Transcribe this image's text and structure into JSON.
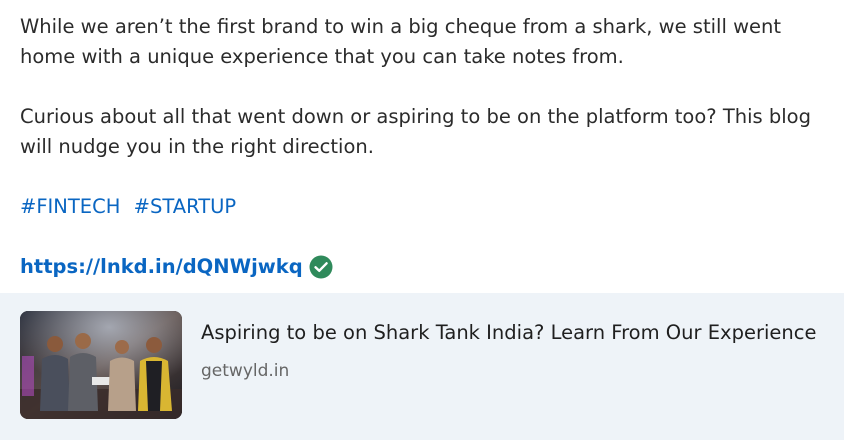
{
  "post": {
    "paragraph1": "While we aren’t the first brand to win a big cheque from a shark, we still went home with a unique experience that you can take notes from.",
    "paragraph2": "Curious about all that went down or aspiring to be on the platform too? This blog will nudge you in the right direction.",
    "hashtags": [
      "#FINTECH",
      "#STARTUP"
    ],
    "link": {
      "text": "https://lnkd.in/dQNWjwkq",
      "verified_icon": "check-circle-icon"
    }
  },
  "link_preview": {
    "title": "Aspiring to be on Shark Tank India? Learn From Our Experience",
    "domain": "getwyld.in",
    "thumbnail_icon": "photo-thumbnail"
  },
  "colors": {
    "link_blue": "#0a66c2",
    "verified_green": "#2f8a5b",
    "card_bg": "#eef3f8"
  }
}
